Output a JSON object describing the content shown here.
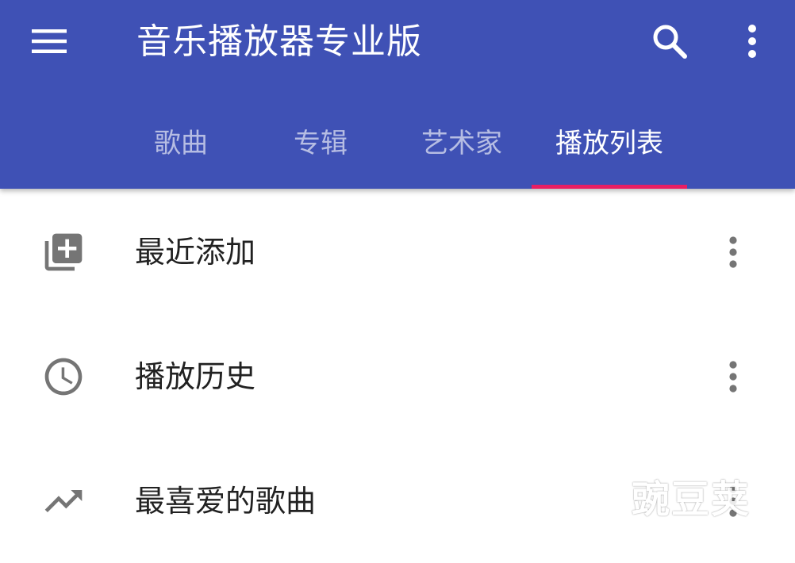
{
  "colors": {
    "toolbar": "#3f51b5",
    "tab_indicator": "#e91e63",
    "list_icon": "#757575",
    "text_primary": "#212121"
  },
  "toolbar": {
    "title": "音乐播放器专业版",
    "menu_icon": "hamburger-menu-icon",
    "search_icon": "search-icon",
    "overflow_icon": "more-vertical-icon"
  },
  "tabs": [
    {
      "label": "歌曲",
      "active": false
    },
    {
      "label": "专辑",
      "active": false
    },
    {
      "label": "艺术家",
      "active": false
    },
    {
      "label": "播放列表",
      "active": true
    }
  ],
  "playlists": [
    {
      "label": "最近添加",
      "icon": "library-add-icon"
    },
    {
      "label": "播放历史",
      "icon": "clock-icon"
    },
    {
      "label": "最喜爱的歌曲",
      "icon": "trending-up-icon"
    }
  ],
  "watermark": {
    "text": "豌豆荚"
  }
}
